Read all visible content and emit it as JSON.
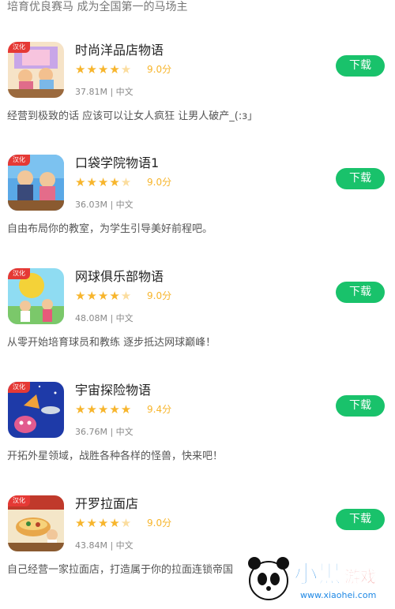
{
  "header": {
    "intro": "培育优良赛马 成为全国第一的马场主"
  },
  "apps": [
    {
      "title": "时尚洋品店物语",
      "score": "9.0分",
      "rating": 4.5,
      "meta": "37.81M | 中文",
      "desc": "经营到极致的话 应该可以让女人疯狂 让男人破产_(:з」",
      "button": "下载",
      "badge": "汉化",
      "icon": "boutique-game-icon"
    },
    {
      "title": "口袋学院物语1",
      "score": "9.0分",
      "rating": 4.5,
      "meta": "36.03M | 中文",
      "desc": "自由布局你的教室，为学生引导美好前程吧。",
      "button": "下载",
      "badge": "汉化",
      "icon": "academy-game-icon"
    },
    {
      "title": "网球俱乐部物语",
      "score": "9.0分",
      "rating": 4.5,
      "meta": "48.08M | 中文",
      "desc": "从零开始培育球员和教练 逐步抵达网球巅峰！",
      "button": "下载",
      "badge": "汉化",
      "icon": "tennis-game-icon"
    },
    {
      "title": "宇宙探险物语",
      "score": "9.4分",
      "rating": 5,
      "meta": "36.76M | 中文",
      "desc": "开拓外星领域，战胜各种各样的怪兽，快来吧！",
      "button": "下载",
      "badge": "汉化",
      "icon": "space-game-icon"
    },
    {
      "title": "开罗拉面店",
      "score": "9.0分",
      "rating": 4.5,
      "meta": "43.84M | 中文",
      "desc": "自己经营一家拉面店，打造属于你的拉面连锁帝国",
      "button": "下载",
      "badge": "汉化",
      "icon": "ramen-game-icon"
    }
  ],
  "watermark": {
    "brand_main": "小黑游戏",
    "brand_url": "www.xiaohei.com"
  },
  "colors": {
    "accent_green": "#19c26b",
    "star": "#f7b52c"
  }
}
